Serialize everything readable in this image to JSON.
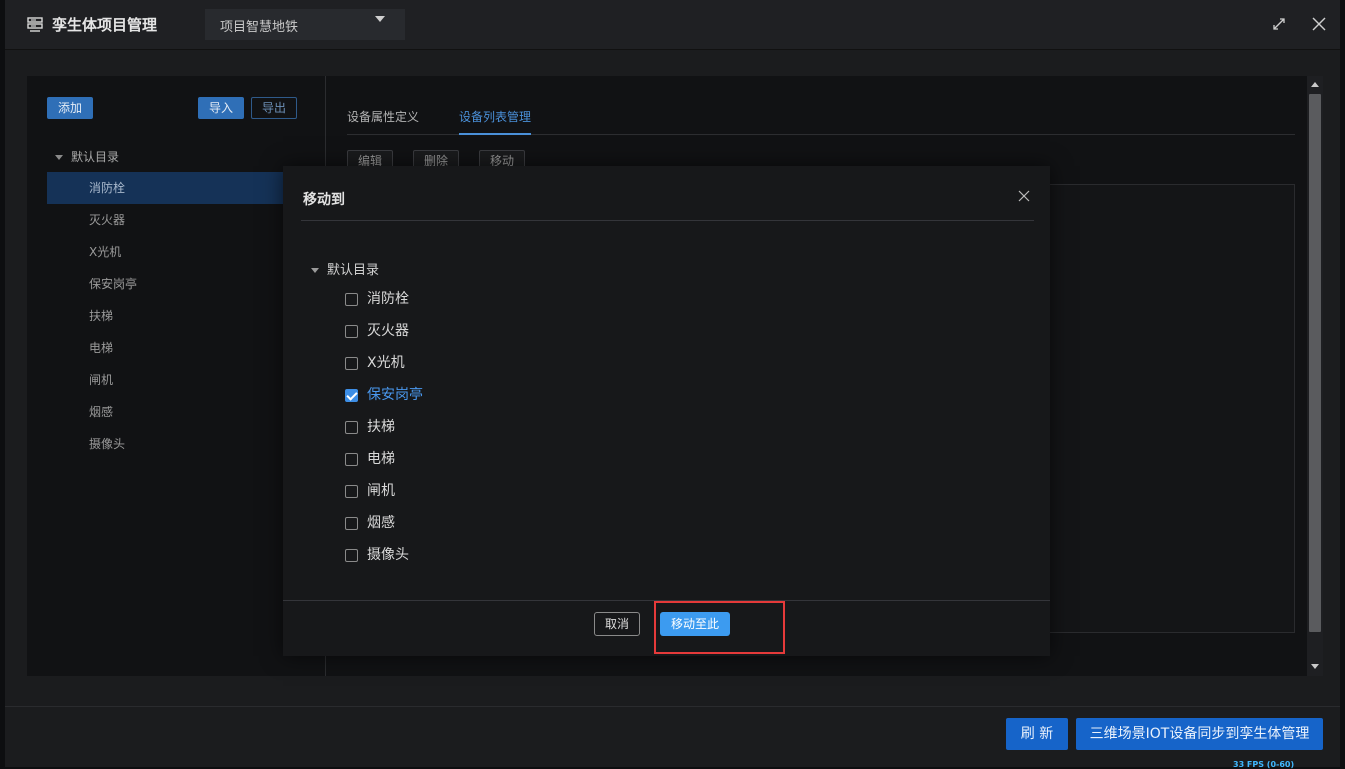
{
  "titlebar": {
    "title": "孪生体项目管理",
    "project_selected": "项目智慧地铁",
    "app_icon": "server-rack-icon",
    "maximize_icon": "expand-arrows-icon",
    "close_icon": "close-icon"
  },
  "left_panel": {
    "add_label": "添加",
    "import_label": "导入",
    "export_label": "导出",
    "root_label": "默认目录",
    "items": [
      "消防栓",
      "灭火器",
      "X光机",
      "保安岗亭",
      "扶梯",
      "电梯",
      "闸机",
      "烟感",
      "摄像头"
    ],
    "active_item": "消防栓"
  },
  "right_panel": {
    "tabs": [
      "设备属性定义",
      "设备列表管理"
    ],
    "active_tab": "设备列表管理",
    "toolbar": [
      "编辑",
      "删除",
      "移动"
    ]
  },
  "modal": {
    "title": "移动到",
    "root_label": "默认目录",
    "items": [
      {
        "label": "消防栓",
        "checked": false
      },
      {
        "label": "灭火器",
        "checked": false
      },
      {
        "label": "X光机",
        "checked": false
      },
      {
        "label": "保安岗亭",
        "checked": true
      },
      {
        "label": "扶梯",
        "checked": false
      },
      {
        "label": "电梯",
        "checked": false
      },
      {
        "label": "闸机",
        "checked": false
      },
      {
        "label": "烟感",
        "checked": false
      },
      {
        "label": "摄像头",
        "checked": false
      }
    ],
    "cancel_label": "取消",
    "confirm_label": "移动至此"
  },
  "footer": {
    "refresh_label": "刷 新",
    "sync_label": "三维场景IOT设备同步到孪生体管理"
  },
  "fps_text": "33 FPS (0-60)",
  "colors": {
    "accent": "#3c9bf0",
    "primary_button": "#1664c9",
    "highlight": "#e53a3a"
  }
}
